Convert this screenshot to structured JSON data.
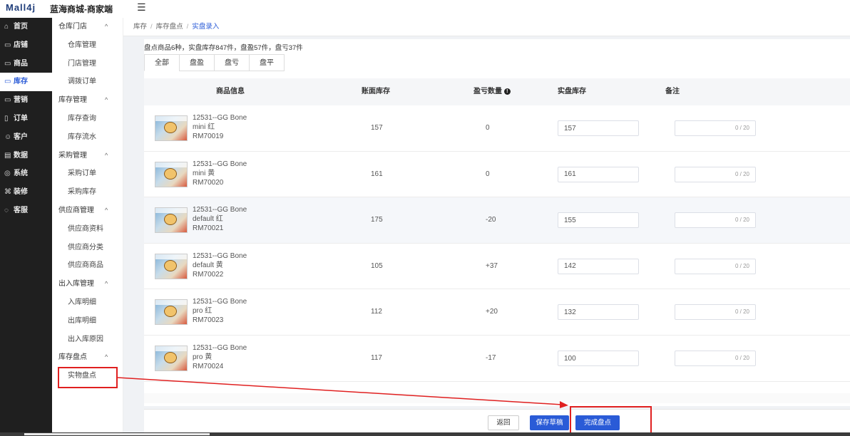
{
  "header": {
    "logo": "Mall4j",
    "shop_name": "蓝海商城-商家端",
    "menu_toggle": "☰"
  },
  "sidebar": {
    "items": [
      {
        "icon": "⌂",
        "label": "首页"
      },
      {
        "icon": "▭",
        "label": "店铺"
      },
      {
        "icon": "▭",
        "label": "商品"
      },
      {
        "icon": "▭",
        "label": "库存"
      },
      {
        "icon": "▭",
        "label": "营销"
      },
      {
        "icon": "▯",
        "label": "订单"
      },
      {
        "icon": "☺",
        "label": "客户"
      },
      {
        "icon": "▤",
        "label": "数据"
      },
      {
        "icon": "◎",
        "label": "系统"
      },
      {
        "icon": "⌘",
        "label": "装修"
      },
      {
        "icon": "◌",
        "label": "客服"
      }
    ],
    "active_index": 3
  },
  "submenu": {
    "groups": [
      {
        "title": "仓库门店",
        "items": [
          "仓库管理",
          "门店管理",
          "调拨订单"
        ]
      },
      {
        "title": "库存管理",
        "items": [
          "库存查询",
          "库存流水"
        ]
      },
      {
        "title": "采购管理",
        "items": [
          "采购订单",
          "采购库存"
        ]
      },
      {
        "title": "供应商管理",
        "items": [
          "供应商资料",
          "供应商分类",
          "供应商商品"
        ]
      },
      {
        "title": "出入库管理",
        "items": [
          "入库明细",
          "出库明细",
          "出入库原因"
        ]
      },
      {
        "title": "库存盘点",
        "items": [
          "实物盘点"
        ]
      }
    ],
    "chevron": "^"
  },
  "breadcrumb": {
    "items": [
      "库存",
      "库存盘点",
      "实盘录入"
    ],
    "separator": "/"
  },
  "summary": "盘点商品6种，实盘库存847件，盘盈57件，盘亏37件",
  "tabs": [
    "全部",
    "盘盈",
    "盘亏",
    "盘平"
  ],
  "table": {
    "headers": {
      "product": "商品信息",
      "book_stock": "账面库存",
      "diff": "盈亏数量",
      "actual": "实盘库存",
      "remark": "备注"
    },
    "rows": [
      {
        "name": "12531--GG Bone",
        "spec": "mini 红",
        "code": "RM70019",
        "book": "157",
        "diff": "0",
        "actual": "157",
        "count": "0 / 20"
      },
      {
        "name": "12531--GG Bone",
        "spec": "mini 黄",
        "code": "RM70020",
        "book": "161",
        "diff": "0",
        "actual": "161",
        "count": "0 / 20"
      },
      {
        "name": "12531--GG Bone",
        "spec": "default 红",
        "code": "RM70021",
        "book": "175",
        "diff": "-20",
        "actual": "155",
        "count": "0 / 20"
      },
      {
        "name": "12531--GG Bone",
        "spec": "default 黄",
        "code": "RM70022",
        "book": "105",
        "diff": "+37",
        "actual": "142",
        "count": "0 / 20"
      },
      {
        "name": "12531--GG Bone",
        "spec": "pro 红",
        "code": "RM70023",
        "book": "112",
        "diff": "+20",
        "actual": "132",
        "count": "0 / 20"
      },
      {
        "name": "12531--GG Bone",
        "spec": "pro 黄",
        "code": "RM70024",
        "book": "117",
        "diff": "-17",
        "actual": "100",
        "count": "0 / 20"
      }
    ]
  },
  "footer": {
    "back": "返回",
    "save_draft": "保存草稿",
    "complete": "完成盘点"
  },
  "colors": {
    "accent": "#2a5bd7",
    "annotation": "#e02020",
    "sidebar_bg": "#1f1f1f"
  }
}
